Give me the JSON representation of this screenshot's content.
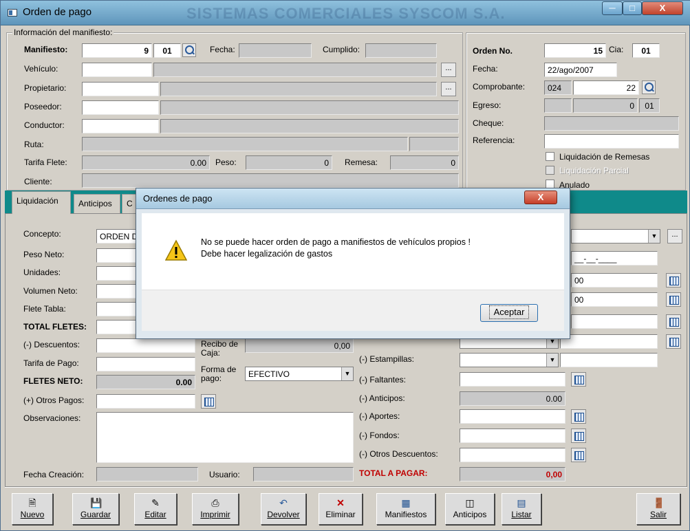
{
  "window": {
    "title": "Orden de pago",
    "watermark": "SISTEMAS COMERCIALES SYSCOM S.A."
  },
  "manifest": {
    "group_title": "Información del manifiesto:",
    "manifiesto_label": "Manifiesto:",
    "manifiesto_value": "9",
    "manifiesto_cia": "01",
    "fecha_label": "Fecha:",
    "cumplido_label": "Cumplido:",
    "vehiculo_label": "Vehículo:",
    "propietario_label": "Propietario:",
    "poseedor_label": "Poseedor:",
    "conductor_label": "Conductor:",
    "ruta_label": "Ruta:",
    "tarifa_flete_label": "Tarifa Flete:",
    "tarifa_flete_value": "0.00",
    "peso_label": "Peso:",
    "peso_value": "0",
    "remesa_label": "Remesa:",
    "remesa_value": "0",
    "cliente_label": "Cliente:",
    "dots": "..."
  },
  "order": {
    "orden_label": "Orden No.",
    "orden_value": "15",
    "cia_label": "Cia:",
    "cia_value": "01",
    "fecha_label": "Fecha:",
    "fecha_value": "22/ago/2007",
    "comprobante_label": "Comprobante:",
    "comprobante_code": "024",
    "comprobante_num": "22",
    "egreso_label": "Egreso:",
    "egreso_value": "0",
    "egreso_code": "01",
    "cheque_label": "Cheque:",
    "referencia_label": "Referencia:",
    "liq_remesas": "Liquidación de Remesas",
    "liq_parcial": "Liquidación Parcial",
    "anulado": "Anulado"
  },
  "tabs": [
    "Liquidación",
    "Anticipos",
    "C"
  ],
  "liquidacion": {
    "concepto_label": "Concepto:",
    "concepto_value": "ORDEN D",
    "peso_neto_label": "Peso Neto:",
    "unidades_label": "Unidades:",
    "volumen_neto_label": "Volumen Neto:",
    "flete_tabla_label": "Flete Tabla:",
    "total_fletes_label": "TOTAL FLETES:",
    "descuentos_label": "(-) Descuentos:",
    "tarifa_pago_label": "Tarifa de Pago:",
    "fletes_neto_label": "FLETES NETO:",
    "fletes_neto_value": "0.00",
    "otros_pagos_label": "(+) Otros Pagos:",
    "observaciones_label": "Observaciones:",
    "fecha_creacion_label": "Fecha Creación:",
    "usuario_label": "Usuario:",
    "recibo_caja_label": "Recibo de Caja:",
    "recibo_caja_value": "0,00",
    "forma_pago_label": "Forma de pago:",
    "forma_pago_value": "EFECTIVO",
    "right_date_mask": "__-__-____",
    "right_val1": "00",
    "right_val2": "00",
    "estampillas_label": "(-) Estampillas:",
    "faltantes_label": "(-) Faltantes:",
    "anticipos_label": "(-) Anticipos:",
    "anticipos_value": "0.00",
    "aportes_label": "(-) Aportes:",
    "fondos_label": "(-) Fondos:",
    "otros_descuentos_label": "(-) Otros Descuentos:",
    "total_pagar_label": "TOTAL A PAGAR:",
    "total_pagar_value": "0,00"
  },
  "toolbar": [
    "Nuevo",
    "Guardar",
    "Editar",
    "Imprimir",
    "Devolver",
    "Eliminar",
    "Manifiestos",
    "Anticipos",
    "Listar",
    "Salir"
  ],
  "dialog": {
    "title": "Ordenes de pago",
    "line1": "No se puede hacer orden de pago a manifiestos de vehículos propios !",
    "line2": "Debe hacer legalización de gastos",
    "ok_label": "Aceptar",
    "close_symbol": "X",
    "warning_icon": "warning-icon"
  },
  "colors": {
    "tabstrip": "#0f8a8a",
    "total_red": "#c00000"
  }
}
